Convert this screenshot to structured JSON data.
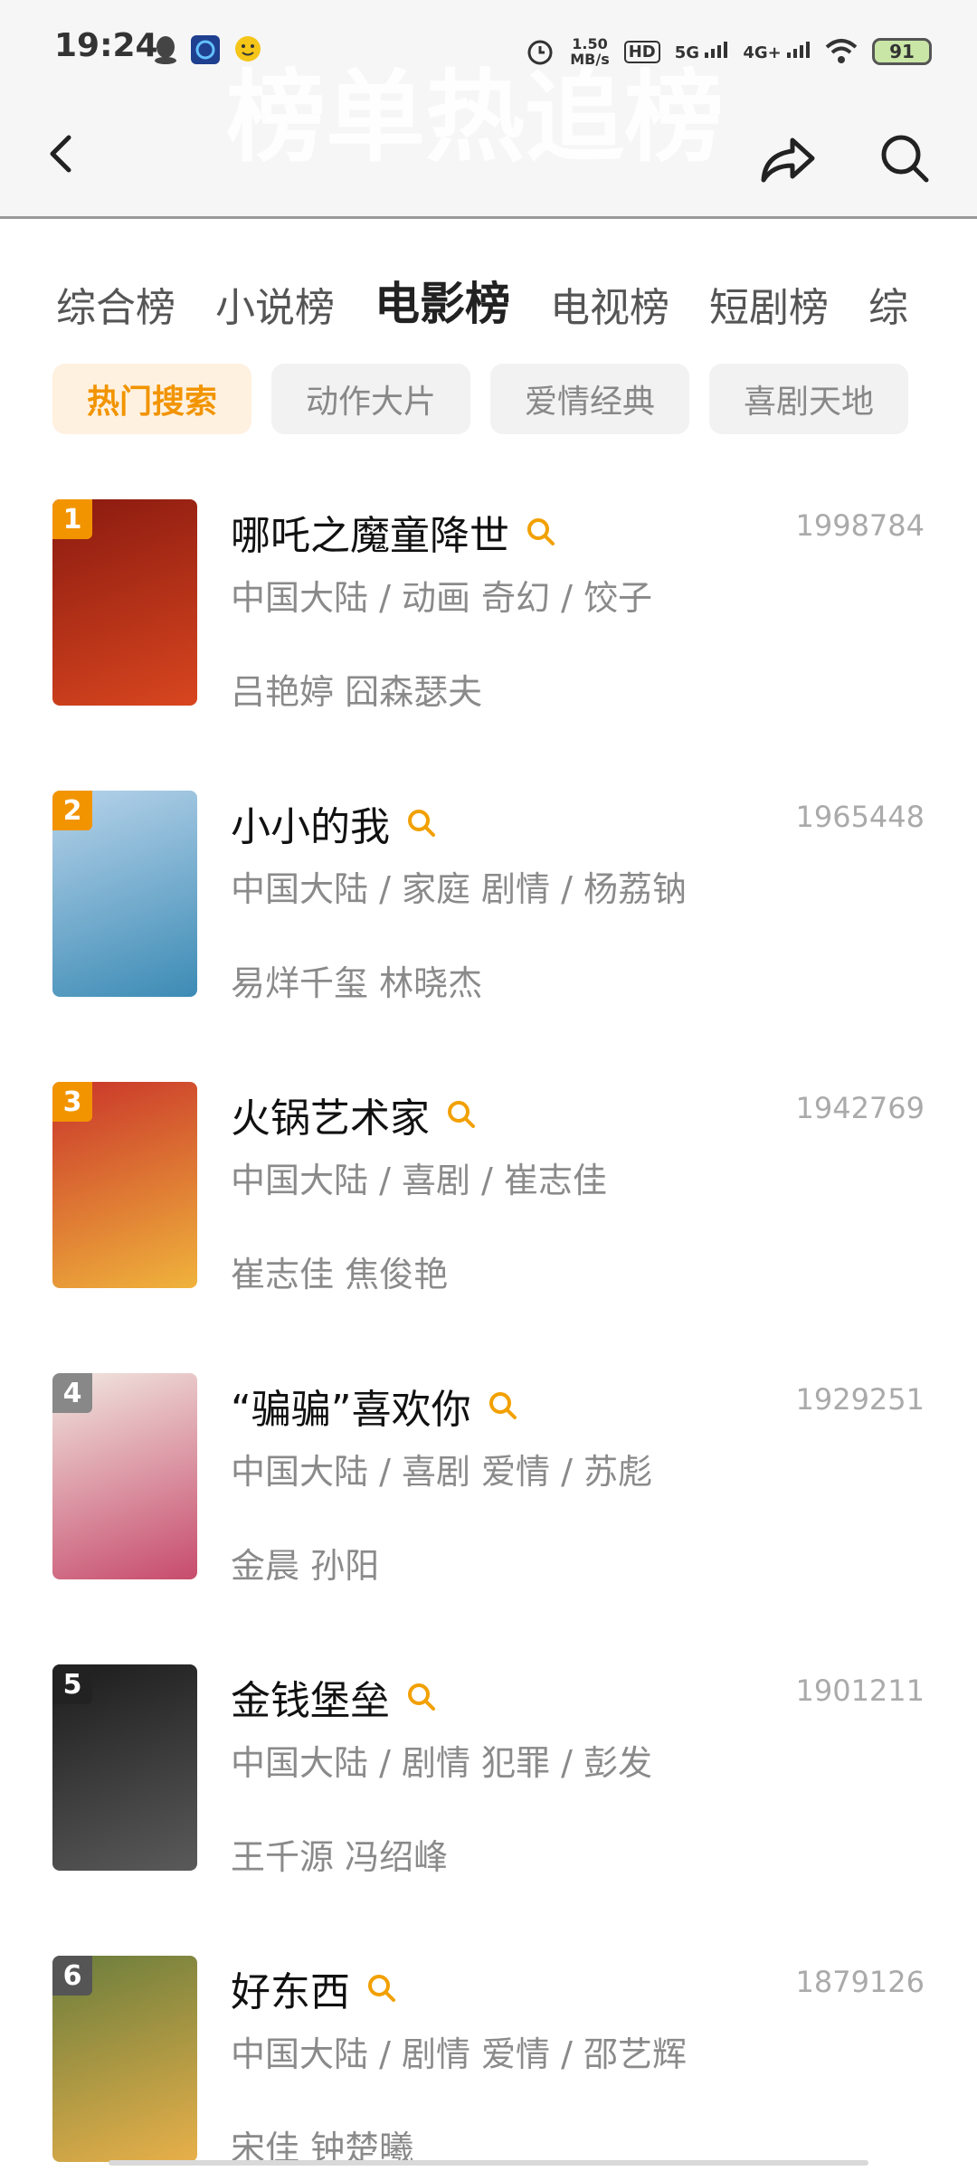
{
  "status": {
    "time": "19:24",
    "speed_value": "1.50",
    "speed_unit": "MB/s",
    "hd": "HD",
    "net1": "5G",
    "net2": "4G+",
    "battery": "91"
  },
  "header": {
    "ghost_title": "榜单热追榜"
  },
  "category_tabs": [
    "综合榜",
    "小说榜",
    "电影榜",
    "电视榜",
    "短剧榜",
    "综"
  ],
  "active_category": "电影榜",
  "chips": [
    "热门搜索",
    "动作大片",
    "爱情经典",
    "喜剧天地"
  ],
  "movies": [
    {
      "rank": "1",
      "title": "哪吒之魔童降世",
      "score": "1998784",
      "meta": "中国大陆 / 动画 奇幻 / 饺子",
      "cast": "吕艳婷 囧森瑟夫",
      "rank_color": "#f29400",
      "poster_colors": [
        "#8a1a10",
        "#d8461f"
      ]
    },
    {
      "rank": "2",
      "title": "小小的我",
      "score": "1965448",
      "meta": "中国大陆 / 家庭 剧情 / 杨荔钠",
      "cast": "易烊千玺 林晓杰",
      "rank_color": "#f29400",
      "poster_colors": [
        "#b7d3ea",
        "#3c8bb5"
      ]
    },
    {
      "rank": "3",
      "title": "火锅艺术家",
      "score": "1942769",
      "meta": "中国大陆 / 喜剧 / 崔志佳",
      "cast": "崔志佳 焦俊艳",
      "rank_color": "#f29400",
      "poster_colors": [
        "#c9352a",
        "#f0b33c"
      ]
    },
    {
      "rank": "4",
      "title": "“骗骗”喜欢你",
      "score": "1929251",
      "meta": "中国大陆 / 喜剧 爱情 / 苏彪",
      "cast": "金晨 孙阳",
      "rank_color": "#888888",
      "poster_colors": [
        "#f1e7e0",
        "#c74b6c"
      ]
    },
    {
      "rank": "5",
      "title": "金钱堡垒",
      "score": "1901211",
      "meta": "中国大陆 / 剧情 犯罪 / 彭发",
      "cast": "王千源 冯绍峰",
      "rank_color": "#222222",
      "poster_colors": [
        "#1c1c1c",
        "#5a5a5a"
      ]
    },
    {
      "rank": "6",
      "title": "好东西",
      "score": "1879126",
      "meta": "中国大陆 / 剧情 爱情 / 邵艺辉",
      "cast": "宋佳 钟楚曦",
      "rank_color": "#555555",
      "poster_colors": [
        "#6a7d3c",
        "#e8b04a"
      ]
    }
  ]
}
